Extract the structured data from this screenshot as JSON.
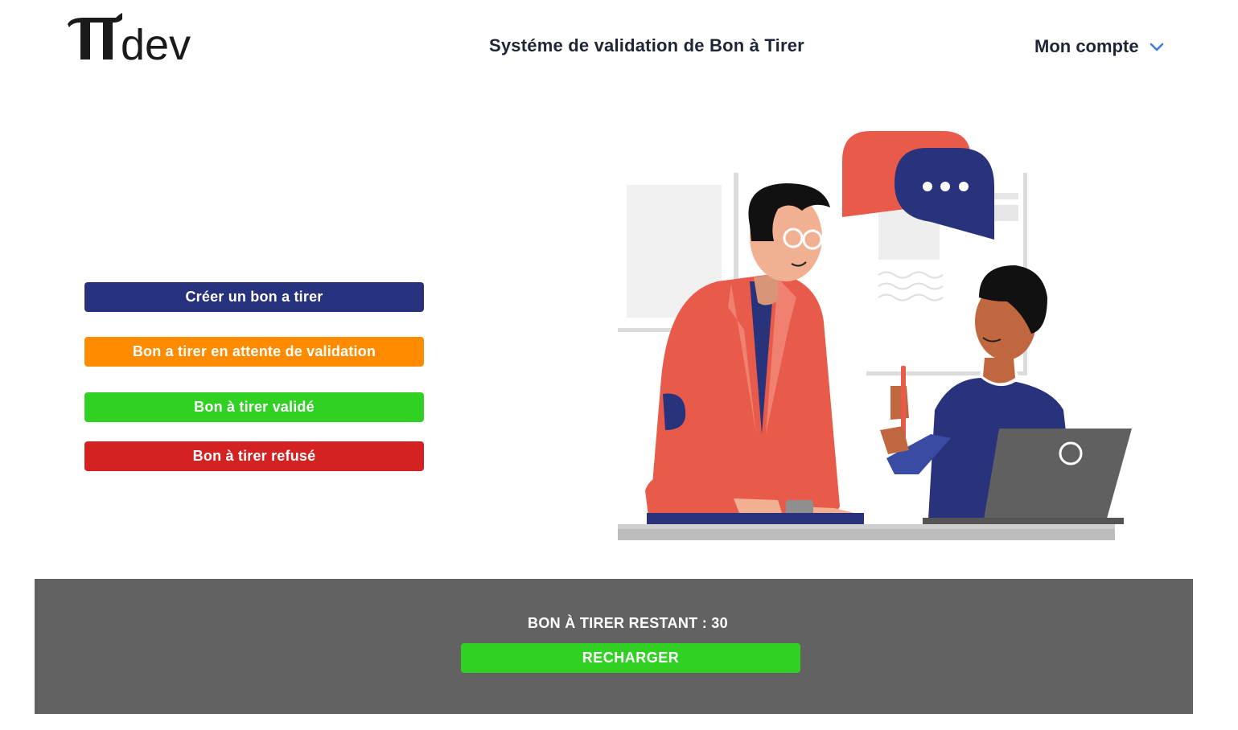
{
  "header": {
    "logo_text": "dev",
    "title": "Systéme de validation de Bon à Tirer",
    "account_label": "Mon compte",
    "account_icon": "chevron-down-icon"
  },
  "actions": {
    "create_label": "Créer un bon a tirer",
    "pending_label": "Bon a tirer en attente de validation",
    "validated_label": "Bon à tirer validé",
    "refused_label": "Bon à tirer refusé"
  },
  "footer": {
    "remaining_text": "BON À TIRER RESTANT : 30",
    "recharge_label": "RECHARGER"
  },
  "colors": {
    "primary_blue": "#27327e",
    "pending_orange": "#ff8c00",
    "validated_green": "#31d124",
    "refused_red": "#d42222",
    "panel_gray": "#626262",
    "accent_chevron": "#3d7de0"
  }
}
